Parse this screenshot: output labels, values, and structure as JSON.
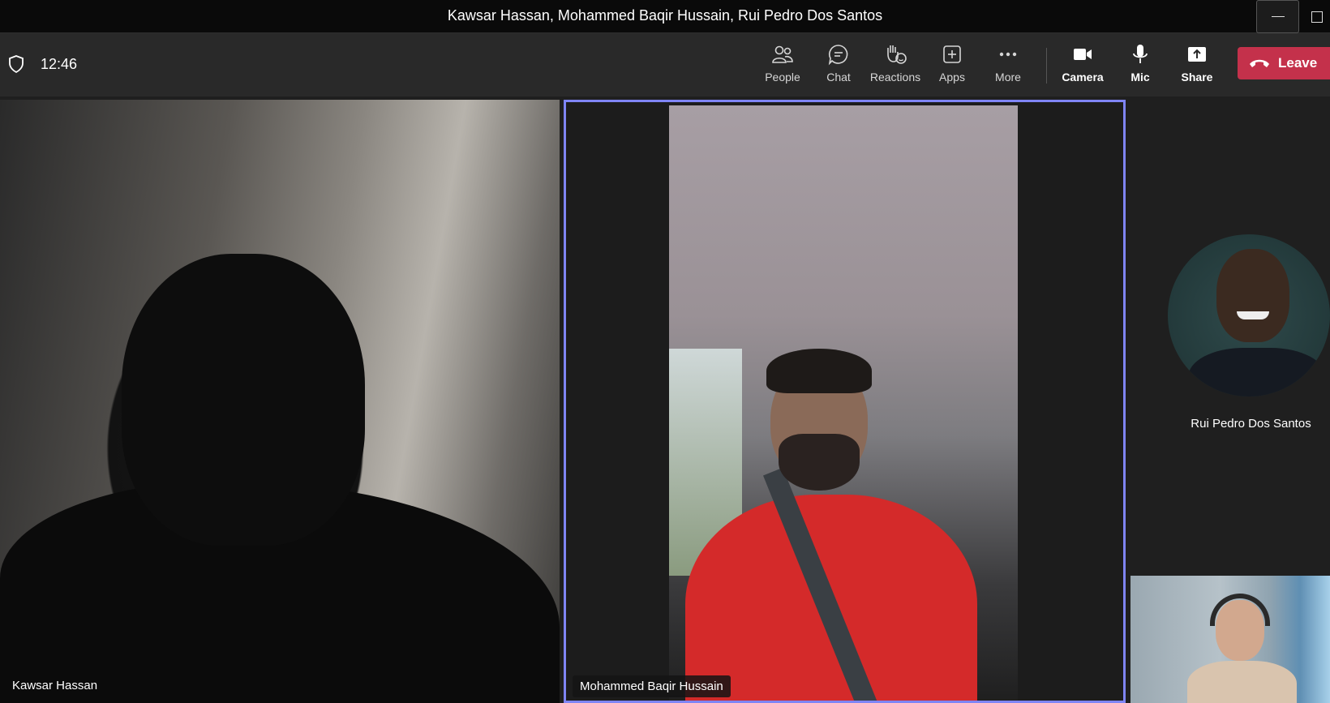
{
  "window": {
    "title": "Kawsar Hassan, Mohammed Baqir Hussain, Rui Pedro Dos Santos"
  },
  "toolbar": {
    "time": "12:46",
    "buttons": {
      "people": "People",
      "chat": "Chat",
      "reactions": "Reactions",
      "apps": "Apps",
      "more": "More",
      "camera": "Camera",
      "mic": "Mic",
      "share": "Share"
    },
    "leave_label": "Leave",
    "accent_color": "#c4314b"
  },
  "participants": {
    "left_tile_name": "Kawsar Hassan",
    "center_tile_name": "Mohammed Baqir Hussain",
    "avatar_name": "Rui Pedro Dos Santos",
    "active_speaker_border": "#7f85f5"
  },
  "icons": [
    "shield-icon",
    "people-icon",
    "chat-icon",
    "reactions-icon",
    "apps-icon",
    "more-icon",
    "camera-icon",
    "mic-icon",
    "share-icon",
    "phone-hangup-icon",
    "minimize-icon",
    "maximize-icon"
  ]
}
